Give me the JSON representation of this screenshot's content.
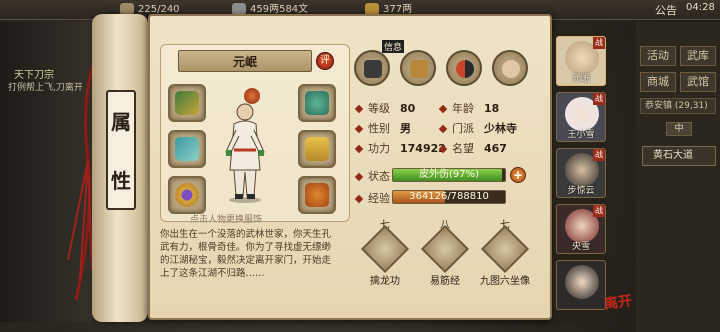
{
  "topbar": {
    "capacity": "225/240",
    "money": "459两584文",
    "ingots": "377两",
    "notice": "公告",
    "time": "04:28"
  },
  "quest": {
    "title": "天下刀宗",
    "text": "打例帮上飞,刀离开"
  },
  "scroll_label": [
    "属",
    "性"
  ],
  "character": {
    "name": "元岷",
    "ping_label": "评",
    "caption": "点击人物更换服饰",
    "backstory": "你出生在一个没落的武林世家，你天生孔武有力，根骨奇佳。你为了寻找虚无缥缈的江湖秘宝，毅然决定离开家门，开始走上了这条江湖不归路……"
  },
  "top_icons": [
    "talisman-icon",
    "inventory-icon",
    "taiji-icon",
    "meridian-icon"
  ],
  "top_icon_label": "信息",
  "stats": {
    "level_label": "等级",
    "level": "80",
    "age_label": "年龄",
    "age": "18",
    "gender_label": "性别",
    "gender": "男",
    "sect_label": "门派",
    "sect": "少林寺",
    "power_label": "功力",
    "power": "174922",
    "fame_label": "名望",
    "fame": "467",
    "status_label": "状态",
    "status_text": "皮外伤(97%)",
    "status_pct": 97,
    "exp_label": "经验",
    "exp_text": "364126/788810",
    "exp_pct": 46
  },
  "skills": [
    {
      "level": "七",
      "name": "擒龙功"
    },
    {
      "level": "八",
      "name": "易筋经"
    },
    {
      "level": "七",
      "name": "九图六坐像"
    }
  ],
  "roster": [
    {
      "name": "元岷",
      "tag": "战"
    },
    {
      "name": "王小雪",
      "tag": "战"
    },
    {
      "name": "步惊云",
      "tag": "战"
    },
    {
      "name": "央雪",
      "tag": "战"
    },
    {
      "name": "",
      "tag": ""
    }
  ],
  "menu": {
    "b1": "活动",
    "b2": "武库",
    "b3": "商城",
    "b4": "武馆",
    "field_label": "恭安镇",
    "field_coords": "(29,31)",
    "tab": "中",
    "location": "黄石大道"
  },
  "leave_label": "离开"
}
